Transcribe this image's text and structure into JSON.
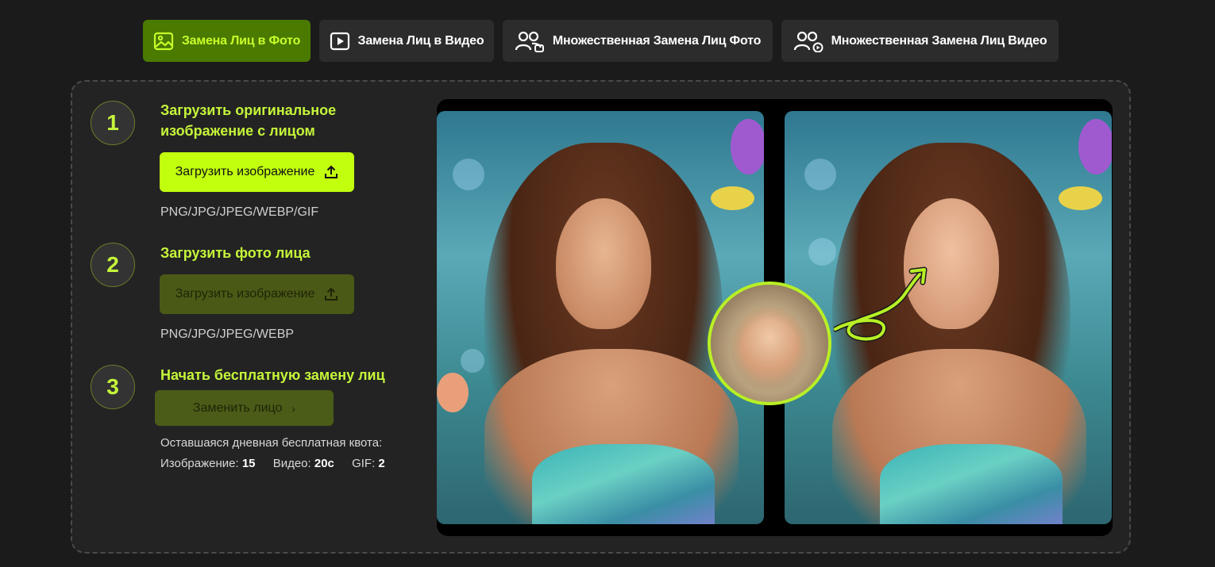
{
  "tabs": [
    {
      "label": "Замена Лиц в Фото",
      "icon": "image-icon",
      "active": true
    },
    {
      "label": "Замена Лиц в Видео",
      "icon": "video-play-icon",
      "active": false
    },
    {
      "label": "Множественная Замена Лиц Фото",
      "icon": "multi-face-photo-icon",
      "active": false
    },
    {
      "label": "Множественная Замена Лиц Видео",
      "icon": "multi-face-video-icon",
      "active": false
    }
  ],
  "steps": [
    {
      "number": "1",
      "title_line1": "Загрузить оригинальное",
      "title_line2": "изображение с лицом",
      "button": "Загрузить изображение",
      "formats": "PNG/JPG/JPEG/WEBP/GIF"
    },
    {
      "number": "2",
      "title": "Загрузить фото лица",
      "button": "Загрузить изображение",
      "formats": "PNG/JPG/JPEG/WEBP"
    },
    {
      "number": "3",
      "title": "Начать бесплатную замену лиц",
      "button": "Заменить лицо",
      "quota_label": "Оставшаяся дневная бесплатная квота:",
      "quota_image_label": "Изображение:",
      "quota_image_value": "15",
      "quota_video_label": "Видео:",
      "quota_video_value": "20с",
      "quota_gif_label": "GIF:",
      "quota_gif_value": "2"
    }
  ],
  "colors": {
    "accent": "#c2ff0f",
    "accent_text": "#c5f53a",
    "active_tab_bg": "#4a7a00",
    "page_bg": "#1b1b1b",
    "panel_bg": "#232323"
  }
}
